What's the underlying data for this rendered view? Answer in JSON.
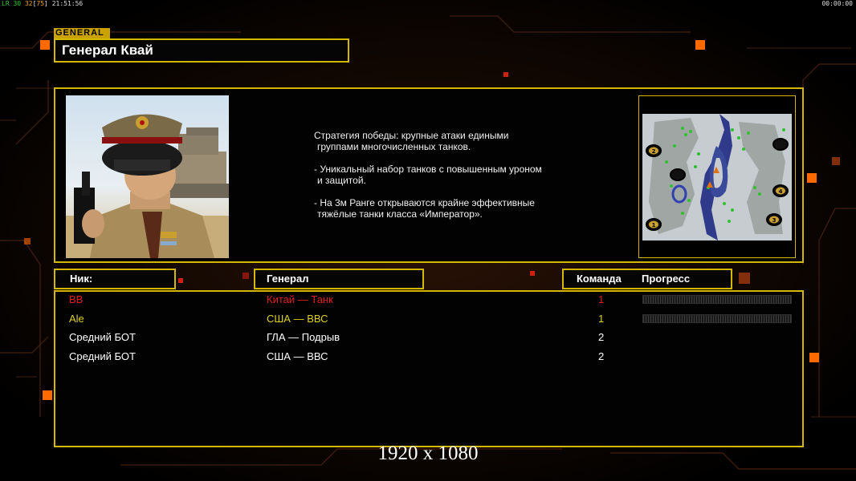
{
  "hud": {
    "left_prefix": "LR",
    "left_a": "30",
    "left_b": "32",
    "left_c": "75",
    "left_time": "21:51:56",
    "right_time": "00:00:00"
  },
  "general": {
    "tag": "GENERAL",
    "name": "Генерал Квай",
    "portrait_icon": "general-portrait",
    "description": [
      [
        "Стратегия победы: крупные атаки едиными",
        " группами многочисленных танков."
      ],
      [
        "- Уникальный набор танков с повышенным уроном",
        " и защитой."
      ],
      [
        "- На 3м Ранге открываются крайне эффективные",
        " тяжёлые танки класса «Император»."
      ]
    ]
  },
  "minimap": {
    "icon": "map-icon",
    "slots": [
      "1",
      "2",
      "3",
      "4"
    ]
  },
  "headers": {
    "nick": "Ник:",
    "general": "Генерал",
    "team": "Команда",
    "progress": "Прогресс"
  },
  "players": [
    {
      "nick": "BB",
      "general": "Китай — Танк",
      "team": "1",
      "color": "#e02020",
      "progress": 0.0,
      "show_progress": true
    },
    {
      "nick": "Ale",
      "general": "США — ВВС",
      "team": "1",
      "color": "#e0d020",
      "progress": 0.0,
      "show_progress": true
    },
    {
      "nick": "Средний БОТ",
      "general": "ГЛА — Подрыв",
      "team": "2",
      "color": "#ffffff",
      "show_progress": false
    },
    {
      "nick": "Средний БОТ",
      "general": "США — ВВС",
      "team": "2",
      "color": "#ffffff",
      "show_progress": false
    }
  ],
  "resolution": "1920 x 1080",
  "colors": {
    "accent": "#d4b800",
    "orange": "#ff6a00",
    "background": "#000000"
  }
}
